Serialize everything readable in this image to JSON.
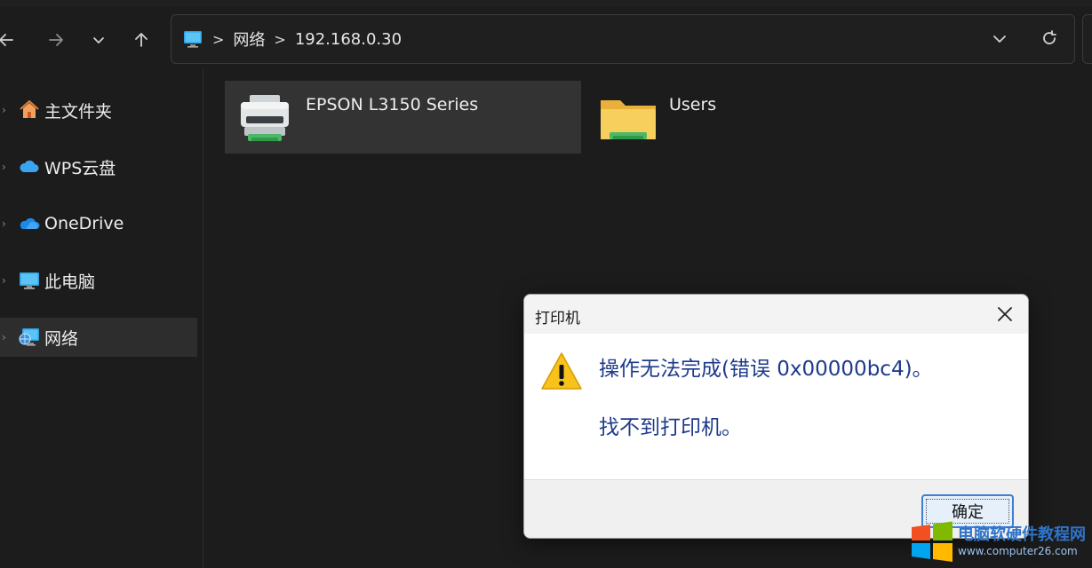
{
  "address": {
    "segments": [
      "网络",
      "192.168.0.30"
    ],
    "separator": ">"
  },
  "sidebar": {
    "items": [
      {
        "label": "主文件夹",
        "icon": "home-icon"
      },
      {
        "label": "WPS云盘",
        "icon": "cloud-icon"
      },
      {
        "label": "OneDrive",
        "icon": "onedrive-icon"
      },
      {
        "label": "此电脑",
        "icon": "computer-icon"
      },
      {
        "label": "网络",
        "icon": "network-icon",
        "active": true
      }
    ]
  },
  "content": {
    "items": [
      {
        "label": "EPSON L3150 Series",
        "icon": "printer-icon",
        "selected": true
      },
      {
        "label": "Users",
        "icon": "folder-icon"
      }
    ]
  },
  "dialog": {
    "title": "打印机",
    "message_line1": "操作无法完成(错误 0x00000bc4)。",
    "message_line2": "找不到打印机。",
    "ok_label": "确定"
  },
  "watermark": {
    "title": "电脑软硬件教程网",
    "url": "www.computer26.com"
  },
  "colors": {
    "background": "#1c1c1c",
    "dialog_text": "#1e3a8a",
    "accent": "#3c7fd6"
  }
}
